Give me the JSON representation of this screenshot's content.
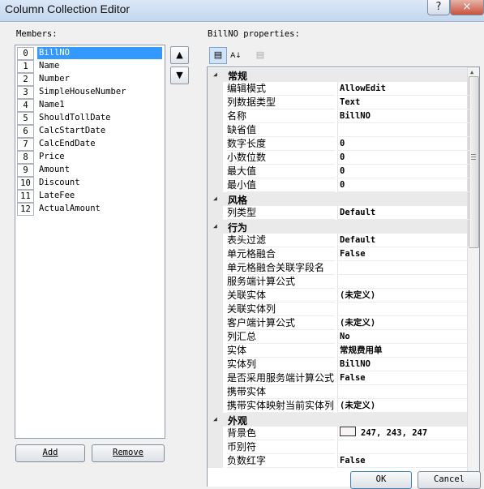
{
  "window": {
    "title": "Column Collection Editor",
    "help_label": "?",
    "close_label": "×"
  },
  "members": {
    "label": "Members:",
    "items": [
      {
        "index": "0",
        "name": "BillNO"
      },
      {
        "index": "1",
        "name": "Name"
      },
      {
        "index": "2",
        "name": "Number"
      },
      {
        "index": "3",
        "name": "SimpleHouseNumber"
      },
      {
        "index": "4",
        "name": "Name1"
      },
      {
        "index": "5",
        "name": "ShouldTollDate"
      },
      {
        "index": "6",
        "name": "CalcStartDate"
      },
      {
        "index": "7",
        "name": "CalcEndDate"
      },
      {
        "index": "8",
        "name": "Price"
      },
      {
        "index": "9",
        "name": "Amount"
      },
      {
        "index": "10",
        "name": "Discount"
      },
      {
        "index": "11",
        "name": "LateFee"
      },
      {
        "index": "12",
        "name": "ActualAmount"
      }
    ],
    "selected_index": 0,
    "move_up_icon": "arrow-up-icon",
    "move_down_icon": "arrow-down-icon",
    "add_label": "Add",
    "remove_label": "Remove"
  },
  "properties": {
    "label": "BillNO properties:",
    "rows": [
      {
        "type": "category",
        "name": "常规"
      },
      {
        "type": "prop",
        "name": "编辑模式",
        "value": "AllowEdit"
      },
      {
        "type": "prop",
        "name": "列数据类型",
        "value": "Text"
      },
      {
        "type": "prop",
        "name": "名称",
        "value": "BillNO"
      },
      {
        "type": "prop",
        "name": "缺省值",
        "value": ""
      },
      {
        "type": "prop",
        "name": "数字长度",
        "value": "0"
      },
      {
        "type": "prop",
        "name": "小数位数",
        "value": "0"
      },
      {
        "type": "prop",
        "name": "最大值",
        "value": "0"
      },
      {
        "type": "prop",
        "name": "最小值",
        "value": "0"
      },
      {
        "type": "category",
        "name": "风格"
      },
      {
        "type": "prop",
        "name": "列类型",
        "value": "Default"
      },
      {
        "type": "category",
        "name": "行为"
      },
      {
        "type": "prop",
        "name": "表头过滤",
        "value": "Default"
      },
      {
        "type": "prop",
        "name": "单元格融合",
        "value": "False"
      },
      {
        "type": "prop",
        "name": "单元格融合关联字段名",
        "value": ""
      },
      {
        "type": "prop",
        "name": "服务端计算公式",
        "value": ""
      },
      {
        "type": "prop",
        "name": "关联实体",
        "value": "(未定义)"
      },
      {
        "type": "prop",
        "name": "关联实体列",
        "value": ""
      },
      {
        "type": "prop",
        "name": "客户端计算公式",
        "value": "(未定义)"
      },
      {
        "type": "prop",
        "name": "列汇总",
        "value": "No"
      },
      {
        "type": "prop",
        "name": "实体",
        "value": "常规费用单"
      },
      {
        "type": "prop",
        "name": "实体列",
        "value": "BillNO"
      },
      {
        "type": "prop",
        "name": "是否采用服务端计算公式",
        "value": "False"
      },
      {
        "type": "prop",
        "name": "携带实体",
        "value": ""
      },
      {
        "type": "prop",
        "name": "携带实体映射当前实体列",
        "value": "(未定义)"
      },
      {
        "type": "category",
        "name": "外观"
      },
      {
        "type": "prop",
        "name": "背景色",
        "value": "247, 243, 247",
        "swatch": "#f7f3f7"
      },
      {
        "type": "prop",
        "name": "币别符",
        "value": ""
      },
      {
        "type": "prop",
        "name": "负数红字",
        "value": "False"
      }
    ]
  },
  "buttons": {
    "ok_label": "OK",
    "cancel_label": "Cancel"
  }
}
